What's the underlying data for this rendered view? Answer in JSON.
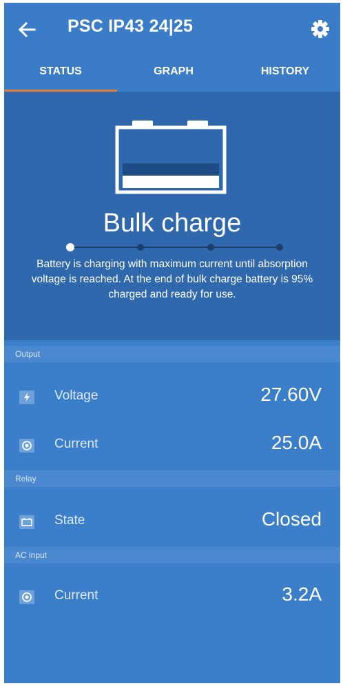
{
  "header": {
    "title": "PSC IP43 24|25",
    "back_icon": "arrow-left-icon",
    "settings_icon": "gear-icon"
  },
  "tabs": [
    {
      "label": "STATUS",
      "active": true
    },
    {
      "label": "GRAPH",
      "active": false
    },
    {
      "label": "HISTORY",
      "active": false
    }
  ],
  "status": {
    "state": "Bulk charge",
    "description": "Battery is charging with maximum current until absorption voltage is reached. At the end of bulk charge battery is 95% charged and ready for use.",
    "step": 1,
    "steps_total": 4
  },
  "sections": {
    "output": {
      "label": "Output",
      "voltage": {
        "label": "Voltage",
        "value": "27.60V",
        "icon": "lightning-icon"
      },
      "current": {
        "label": "Current",
        "value": "25.0A",
        "icon": "current-icon"
      }
    },
    "relay": {
      "label": "Relay",
      "state": {
        "label": "State",
        "value": "Closed",
        "icon": "relay-icon"
      }
    },
    "ac_input": {
      "label": "AC input",
      "current": {
        "label": "Current",
        "value": "3.2A",
        "icon": "current-icon"
      }
    }
  },
  "colors": {
    "appbar": "#3a7cc8",
    "panel": "#2f68ad",
    "accent": "#e57f34"
  }
}
